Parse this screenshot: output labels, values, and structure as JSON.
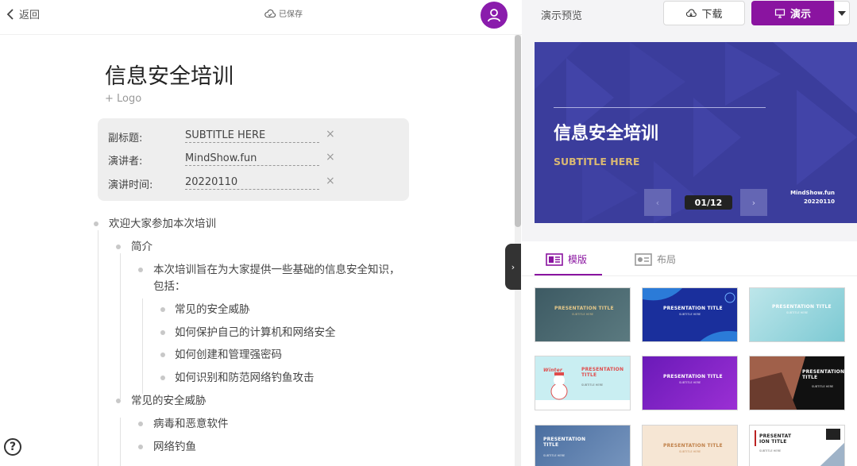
{
  "left": {
    "back_label": "返回",
    "saved_label": "已保存",
    "doc_title": "信息安全培训",
    "logo_add": "+ Logo",
    "meta": [
      {
        "label": "副标题:",
        "value": "SUBTITLE HERE"
      },
      {
        "label": "演讲者:",
        "value": "MindShow.fun"
      },
      {
        "label": "演讲时间:",
        "value": "20220110"
      }
    ],
    "clear_glyph": "×",
    "outline": {
      "n0": "欢迎大家参加本次培训",
      "n1": "简介",
      "n2a": "本次培训旨在为大家提供一些基础的信息安全知识，",
      "n2b": "包括：",
      "n3": "常见的安全威胁",
      "n4": "如何保护自己的计算机和网络安全",
      "n5": "如何创建和管理强密码",
      "n6": "如何识别和防范网络钓鱼攻击",
      "n7": "常见的安全威胁",
      "n8": "病毒和恶意软件",
      "n9": "网络钓鱼"
    },
    "help_glyph": "?",
    "collapse_glyph": "›"
  },
  "right": {
    "preview_label": "演示预览",
    "download_label": "下载",
    "present_label": "演示",
    "slide": {
      "title": "信息安全培训",
      "subtitle": "SUBTITLE HERE",
      "presenter": "MindShow.fun",
      "date": "20220110",
      "counter": "01/12",
      "prev_glyph": "‹",
      "next_glyph": "›"
    },
    "tabs": {
      "template": "模版",
      "layout": "布局"
    },
    "thumbnails": [
      {
        "title": "PRESENTATION TITLE",
        "subtitle": "SUBTITLE HERE"
      },
      {
        "title": "PRESENTATION TITLE",
        "subtitle": "SUBTITLE HERE"
      },
      {
        "title": "PRESENTATION TITLE",
        "subtitle": "SUBTITLE HERE"
      },
      {
        "title": "PRESENTATION TITLE",
        "subtitle": "SUBTITLE HERE",
        "badge": "Winter"
      },
      {
        "title": "PRESENTATION TITLE",
        "subtitle": "SUBTITLE HERE"
      },
      {
        "title": "PRESENTATION TITLE",
        "subtitle": "SUBTITLE HERE"
      },
      {
        "title": "PRESENTATION TITLE",
        "subtitle": "SUBTITLE HERE"
      },
      {
        "title": "PRESENTATION TITLE",
        "subtitle": "SUBTITLE HERE"
      },
      {
        "title": "PRESENTAT ION TITLE",
        "subtitle": "SUBTITLE HERE"
      }
    ]
  },
  "colors": {
    "accent": "#8a14a0",
    "slide_bg": "#3b3d9c",
    "slide_subtitle": "#d9b873"
  },
  "icons": [
    "chevron-left-icon",
    "cloud-saved-icon",
    "user-icon",
    "download-icon",
    "present-icon",
    "caret-down-icon",
    "template-icon",
    "layout-icon",
    "help-icon"
  ]
}
